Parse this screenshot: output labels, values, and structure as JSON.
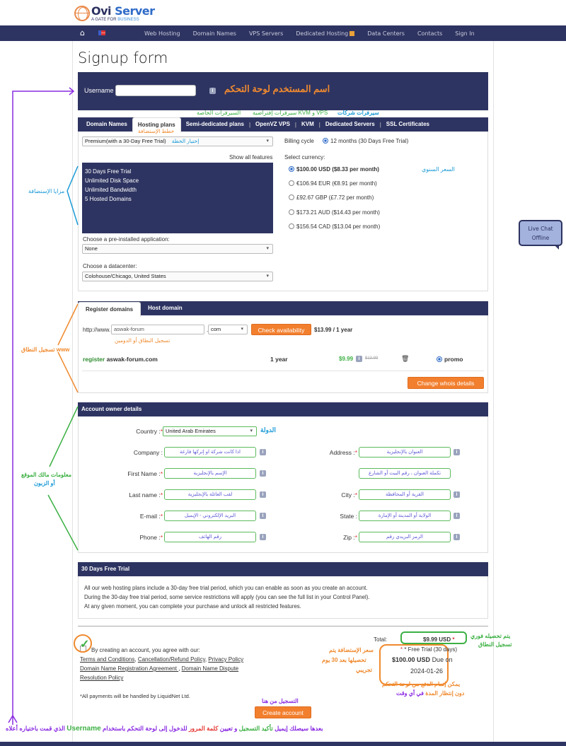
{
  "logo": {
    "main_a": "Ovi ",
    "main_b": "Server",
    "sub_a": "A GATE FOR ",
    "sub_b": "BUSINESS"
  },
  "nav": {
    "home_icon": "⌂",
    "items": [
      "Web Hosting",
      "Domain Names",
      "VPS Servers",
      "Dedicated Hosting",
      "Data Centers",
      "Contacts",
      "Sign In"
    ]
  },
  "page_title": "Signup form",
  "username": {
    "label": "Username",
    "value": "",
    "annotation": "اسم المستخدم لوحة التحكم"
  },
  "tab_annotations": {
    "dedicated": "السيرفرات الخاصة",
    "vps": "سيرفرات إفتراضية KVM و VPS",
    "reseller": "سيرفرات شركات",
    "hosting": "خطط الإستضافة"
  },
  "plan_tabs": [
    "Domain Names",
    "Hosting plans",
    "Semi-dedicated plans",
    "OpenVZ VPS",
    "KVM",
    "Dedicated Servers",
    "SSL Certificates"
  ],
  "plan": {
    "selected": "Premium(with a 30-Day Free Trial)",
    "select_annotation": "إختيار الخطة",
    "show_all": "Show all features",
    "features": [
      "30 Days Free Trial",
      "Unlimited Disk Space",
      "Unlimited Bandwidth",
      "5 Hosted Domains"
    ],
    "features_annotation": "مزايا الإستضافة",
    "app_label": "Choose a pre-installed application:",
    "app_value": "None",
    "dc_label": "Choose a datacenter:",
    "dc_value": "Colohouse/Chicago, United States"
  },
  "billing": {
    "label": "Billing cycle",
    "cycle": "12 months (30 Days Free Trial)",
    "currency_label": "Select currency:",
    "annual_annotation": "السعر السنوي",
    "currencies": [
      {
        "text": "$100.00 USD ($8.33 per month)",
        "selected": true
      },
      {
        "text": "€106.94 EUR (€8.91 per month)",
        "selected": false
      },
      {
        "text": "£92.67 GBP (£7.72 per month)",
        "selected": false
      },
      {
        "text": "$173.21 AUD ($14.43 per month)",
        "selected": false
      },
      {
        "text": "$156.54 CAD ($13.04 per month)",
        "selected": false
      }
    ]
  },
  "domain_tabs": [
    "Register domains",
    "Host domain"
  ],
  "domain": {
    "prefix": "http://www.",
    "name": "aswak-forum",
    "dot": ".",
    "tld": "com",
    "check_btn": "Check availability",
    "price": "$13.99 / 1 year",
    "name_annotation": "تسجيل النطاق أو الدومين",
    "side_annotation": "تسجيل النطاق www",
    "row": {
      "action": "register",
      "domain": "aswak-forum.com",
      "period": "1 year",
      "price": "$9.99",
      "old_price": "$13.99",
      "promo": "promo"
    },
    "whois_btn": "Change whois details"
  },
  "account": {
    "header": "Account owner details",
    "side_annotation_a": "معلومات مالك الموقع",
    "side_annotation_b": "أو الزبون",
    "country_label": "Country :",
    "country_value": "United Arab Emirates",
    "country_annotation": "الدولة",
    "left_fields": [
      {
        "label": "Company :",
        "req": "",
        "hint": "اذا كانت شركة  او إتركها فارغة"
      },
      {
        "label": "First Name :",
        "req": "*",
        "hint": "الإسم بالإنجليزية"
      },
      {
        "label": "Last name :",
        "req": "*",
        "hint": "لقب العائلة بالإنجليزية"
      },
      {
        "label": "E-mail :",
        "req": "*",
        "hint": "البريد الإلكتروني - الإيميل"
      },
      {
        "label": "Phone :",
        "req": "*",
        "hint": "رقم الهاتف"
      }
    ],
    "right_fields": [
      {
        "label": "Address :",
        "req": "*",
        "hint": "العنوان بالإنجليزية"
      },
      {
        "label": "",
        "req": "",
        "hint": "تكملة العنوان ، رقم البيت أو الشارع"
      },
      {
        "label": "City :",
        "req": "*",
        "hint": "القرية أو المحافظة"
      },
      {
        "label": "State :",
        "req": "",
        "hint": "الولاية أو المدينة أو الإمارة"
      },
      {
        "label": "Zip :",
        "req": "*",
        "hint": "الرمز البريدي رقم"
      }
    ]
  },
  "trial": {
    "header": "30 Days Free Trial",
    "lines": [
      "All our web hosting plans include a 30-day free trial period, which you can enable as soon as you create an account.",
      "During the 30-day free trial period, some service restrictions will apply (you can see the full list in your Control Panel).",
      "At any given moment, you can complete your purchase and unlock all restricted features."
    ]
  },
  "agreement": {
    "intro": "By creating an account, you agree with our:",
    "links": [
      "Terms and Conditions",
      "Cancellation/Refund Policy",
      "Privacy Policy",
      "Domain Name Registration Agreement ",
      "Domain Name Dispute Resolution Policy"
    ],
    "payments": "*All payments will be handled by LiquidNet Ltd."
  },
  "totals": {
    "label": "Total:",
    "value": "$9.99 USD",
    "free_trial": "* Free Trial (30 days)",
    "due_amount": "$100.00 USD",
    "due_on": "Due on",
    "due_date": "2024-01-26",
    "instant_annotation_a": "يتم تحصيله فوري",
    "instant_annotation_b": "تسجيل النطاق",
    "hosting_annotation_a": "سعر الإستضافة يتم",
    "hosting_annotation_b": "تحصيلها بعد 30 يوم",
    "hosting_annotation_c": "تجريبي",
    "pay_annotation_a": "يمكن إتمام الدفع من لوحة التحكم",
    "pay_annotation_b": "دون إنتظار المدة",
    "pay_annotation_c": "في أي وقت"
  },
  "create": {
    "annotation": "التسجيل من هنا",
    "button": "Create account",
    "bottom_a": "بعدها سيصلك إيميل",
    "bottom_b": "تأكيد التسجيل",
    "bottom_c": "و تعيين",
    "bottom_d": "كلمة المرور",
    "bottom_e": "للدخول إلى لوحة التحكم باستخدام",
    "bottom_f": "Username",
    "bottom_g": "الذي قمت باختياره أعلاه"
  },
  "live_chat": {
    "line1": "Live Chat",
    "line2": "Offline"
  }
}
